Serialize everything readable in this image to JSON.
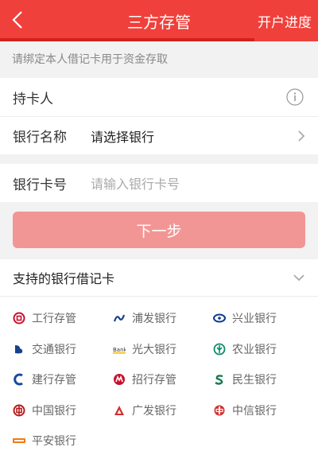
{
  "header": {
    "title": "三方存管",
    "progress_link": "开户进度"
  },
  "notice": "请绑定本人借记卡用于资金存取",
  "form": {
    "cardholder_label": "持卡人",
    "bank_name_label": "银行名称",
    "bank_name_value": "请选择银行",
    "card_number_label": "银行卡号",
    "card_number_placeholder": "请输入银行卡号"
  },
  "next_button": "下一步",
  "support": {
    "title": "支持的银行借记卡",
    "banks": [
      {
        "name": "工行存管",
        "icon": "icbc-icon",
        "color": "#c8102e"
      },
      {
        "name": "浦发银行",
        "icon": "spdb-icon",
        "color": "#1a3f8b"
      },
      {
        "name": "兴业银行",
        "icon": "cib-icon",
        "color": "#0b3b8c"
      },
      {
        "name": "交通银行",
        "icon": "bocom-icon",
        "color": "#1a3f8b"
      },
      {
        "name": "光大银行",
        "icon": "ceb-icon",
        "color": "#f2b600"
      },
      {
        "name": "农业银行",
        "icon": "abc-icon",
        "color": "#0a8a6a"
      },
      {
        "name": "建行存管",
        "icon": "ccb-icon",
        "color": "#1a4aa0"
      },
      {
        "name": "招行存管",
        "icon": "cmb-icon",
        "color": "#c8102e"
      },
      {
        "name": "民生银行",
        "icon": "cmbc-icon",
        "color": "#1d7a55"
      },
      {
        "name": "中国银行",
        "icon": "boc-icon",
        "color": "#b71c1c"
      },
      {
        "name": "广发银行",
        "icon": "cgb-icon",
        "color": "#d32f2f"
      },
      {
        "name": "中信银行",
        "icon": "citic-icon",
        "color": "#d32f2f"
      },
      {
        "name": "平安银行",
        "icon": "pingan-icon",
        "color": "#f07a14"
      }
    ]
  },
  "colors": {
    "brand": "#f0403b",
    "button_disabled": "#f29695"
  }
}
